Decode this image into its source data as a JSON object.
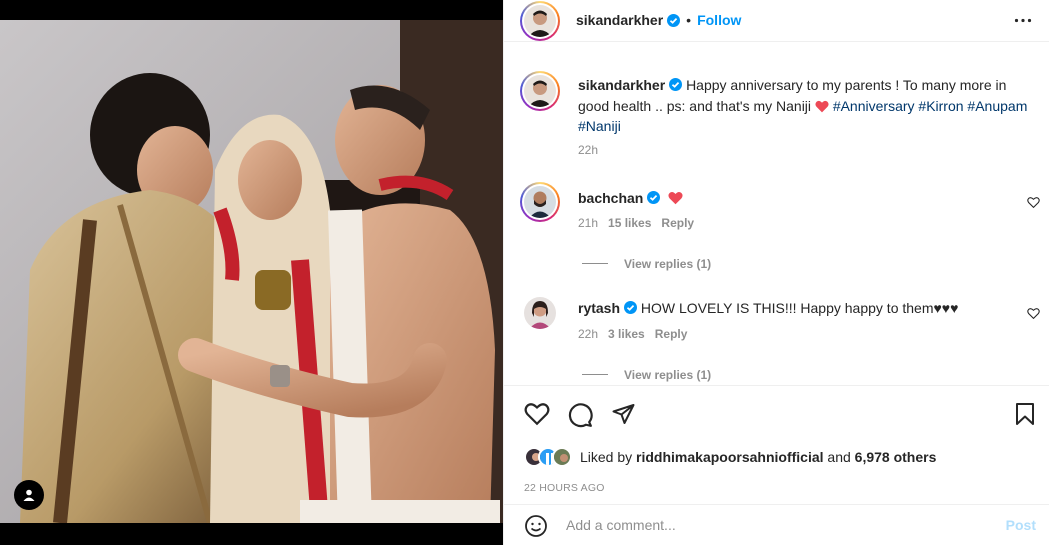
{
  "post": {
    "username": "sikandarkher",
    "follow_label": "Follow",
    "more_icon": "more-options-icon",
    "caption_text": "Happy anniversary to my parents ! To many more in good health .. ps: and that's my Naniji",
    "caption_tags": "#Anniversary",
    "caption_tags2": "#Kirron #Anupam #Naniji",
    "caption_time": "22h"
  },
  "comments": [
    {
      "username": "bachchan",
      "text": "",
      "time": "21h",
      "likes": "15 likes",
      "reply": "Reply",
      "view_replies": "View replies (1)"
    },
    {
      "username": "rytash",
      "text": "HOW LOVELY IS THIS!!! Happy happy to them♥♥♥",
      "time": "22h",
      "likes": "3 likes",
      "reply": "Reply",
      "view_replies": "View replies (1)"
    }
  ],
  "likes": {
    "prefix": "Liked by",
    "user": "riddhimakapoorsahniofficial",
    "and": "and",
    "others": "6,978 others"
  },
  "time_ago": "22 HOURS AGO",
  "add_comment": {
    "placeholder": "Add a comment...",
    "post_label": "Post"
  },
  "colors": {
    "accent": "#0095f6",
    "link": "#00376b",
    "heart": "#ed4956",
    "muted": "#8e8e8e"
  }
}
